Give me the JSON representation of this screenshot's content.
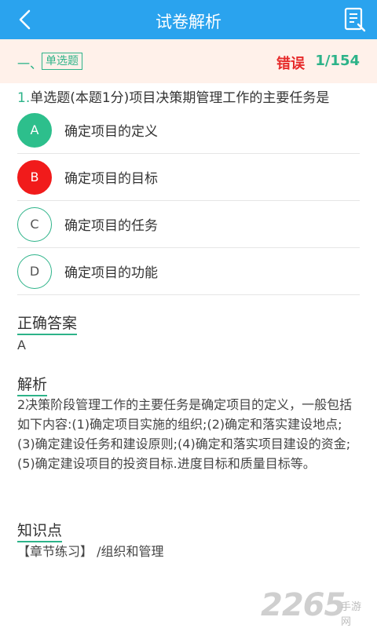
{
  "header": {
    "title": "试卷解析",
    "back_icon": "chevron-left-icon",
    "sheet_icon": "answer-sheet-icon",
    "bar_color": "#2aa3ee"
  },
  "question_bar": {
    "section": "一、",
    "type_tag": "单选题",
    "status": "错误",
    "progress": "1/154"
  },
  "question": {
    "number": "1.",
    "text": "单选题(本题1分)项目决策期管理工作的主要任务是"
  },
  "options": [
    {
      "key": "A",
      "text": "确定项目的定义",
      "state": "correct"
    },
    {
      "key": "B",
      "text": "确定项目的目标",
      "state": "wrong"
    },
    {
      "key": "C",
      "text": "确定项目的任务",
      "state": "normal"
    },
    {
      "key": "D",
      "text": "确定项目的功能",
      "state": "normal"
    }
  ],
  "answer": {
    "title": "正确答案",
    "value": "A"
  },
  "analysis": {
    "title": "解析",
    "text": "2决策阶段管理工作的主要任务是确定项目的定义，一般包括如下内容:(1)确定项目实施的组织;(2)确定和落实建设地点;(3)确定建设任务和建设原则;(4)确定和落实项目建设的资金;(5)确定建设项目的投资目标.进度目标和质量目标等。"
  },
  "knowledge": {
    "title": "知识点",
    "text": "【章节练习】 /组织和管理"
  },
  "watermark": {
    "number": "2265",
    "text": "手游网"
  },
  "colors": {
    "accent": "#2db389",
    "correct": "#2dbf8c",
    "wrong": "#f11b1b",
    "status_red": "#e62a2a"
  }
}
